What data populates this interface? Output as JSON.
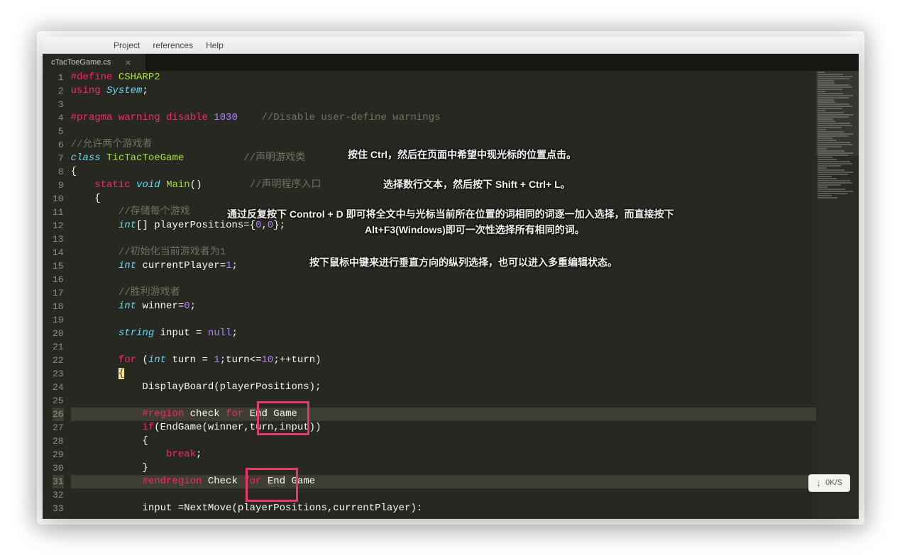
{
  "menubar": {
    "items": [
      "Project",
      "references",
      "Help"
    ]
  },
  "tab": {
    "name": "cTacToeGame.cs",
    "close": "×"
  },
  "gutter": {
    "start": 1,
    "end": 33
  },
  "code_lines": [
    [
      {
        "c": "kw-red",
        "t": "#define"
      },
      {
        "c": "white",
        "t": " "
      },
      {
        "c": "name",
        "t": "CSHARP2"
      }
    ],
    [
      {
        "c": "kw-red",
        "t": "using"
      },
      {
        "c": "white",
        "t": " "
      },
      {
        "c": "kw-blue",
        "t": "System"
      },
      {
        "c": "white",
        "t": ";"
      }
    ],
    [],
    [
      {
        "c": "kw-red",
        "t": "#pragma warning disable"
      },
      {
        "c": "white",
        "t": " "
      },
      {
        "c": "num",
        "t": "1030"
      },
      {
        "c": "white",
        "t": "    "
      },
      {
        "c": "cmt",
        "t": "//Disable user-define warnings"
      }
    ],
    [],
    [
      {
        "c": "cmt",
        "t": "//允许两个游戏者"
      }
    ],
    [
      {
        "c": "kw-blue",
        "t": "class"
      },
      {
        "c": "white",
        "t": " "
      },
      {
        "c": "name",
        "t": "TicTacToeGame"
      },
      {
        "c": "white",
        "t": "          "
      },
      {
        "c": "cmt",
        "t": "//声明游戏类"
      }
    ],
    [
      {
        "c": "white",
        "t": "{"
      }
    ],
    [
      {
        "c": "white",
        "t": "    "
      },
      {
        "c": "kw-red",
        "t": "static"
      },
      {
        "c": "white",
        "t": " "
      },
      {
        "c": "kw-blue",
        "t": "void"
      },
      {
        "c": "white",
        "t": " "
      },
      {
        "c": "fn",
        "t": "Main"
      },
      {
        "c": "white",
        "t": "()        "
      },
      {
        "c": "cmt",
        "t": "//声明程序入口"
      }
    ],
    [
      {
        "c": "white",
        "t": "    {"
      }
    ],
    [
      {
        "c": "white",
        "t": "        "
      },
      {
        "c": "cmt",
        "t": "//存储每个游戏"
      }
    ],
    [
      {
        "c": "white",
        "t": "        "
      },
      {
        "c": "kw-blue",
        "t": "int"
      },
      {
        "c": "white",
        "t": "[] playerPositions={"
      },
      {
        "c": "num",
        "t": "0"
      },
      {
        "c": "white",
        "t": ","
      },
      {
        "c": "num",
        "t": "0"
      },
      {
        "c": "white",
        "t": "};"
      }
    ],
    [],
    [
      {
        "c": "white",
        "t": "        "
      },
      {
        "c": "cmt",
        "t": "//初始化当前游戏者为1"
      }
    ],
    [
      {
        "c": "white",
        "t": "        "
      },
      {
        "c": "kw-blue",
        "t": "int"
      },
      {
        "c": "white",
        "t": " currentPlayer="
      },
      {
        "c": "num",
        "t": "1"
      },
      {
        "c": "white",
        "t": ";"
      }
    ],
    [],
    [
      {
        "c": "white",
        "t": "        "
      },
      {
        "c": "cmt",
        "t": "//胜利游戏者"
      }
    ],
    [
      {
        "c": "white",
        "t": "        "
      },
      {
        "c": "kw-blue",
        "t": "int"
      },
      {
        "c": "white",
        "t": " winner="
      },
      {
        "c": "num",
        "t": "0"
      },
      {
        "c": "white",
        "t": ";"
      }
    ],
    [],
    [
      {
        "c": "white",
        "t": "        "
      },
      {
        "c": "kw-blue",
        "t": "string"
      },
      {
        "c": "white",
        "t": " input = "
      },
      {
        "c": "num",
        "t": "null"
      },
      {
        "c": "white",
        "t": ";"
      }
    ],
    [],
    [
      {
        "c": "white",
        "t": "        "
      },
      {
        "c": "kw-red",
        "t": "for"
      },
      {
        "c": "white",
        "t": " ("
      },
      {
        "c": "kw-blue",
        "t": "int"
      },
      {
        "c": "white",
        "t": " turn = "
      },
      {
        "c": "num",
        "t": "1"
      },
      {
        "c": "white",
        "t": ";turn<="
      },
      {
        "c": "num",
        "t": "10"
      },
      {
        "c": "white",
        "t": ";++turn)"
      }
    ],
    [
      {
        "c": "white",
        "t": "        "
      },
      {
        "c": "bracket-hl",
        "t": "{"
      }
    ],
    [
      {
        "c": "white",
        "t": "            DisplayBoard(playerPositions);"
      }
    ],
    [],
    [
      {
        "c": "white",
        "t": "            "
      },
      {
        "c": "kw-red",
        "t": "#region"
      },
      {
        "c": "white",
        "t": " check "
      },
      {
        "c": "kw-red",
        "t": "for"
      },
      {
        "c": "white",
        "t": " "
      },
      {
        "c": "sel",
        "t": "End"
      },
      {
        "c": "white",
        "t": " Game"
      }
    ],
    [
      {
        "c": "white",
        "t": "            "
      },
      {
        "c": "kw-red",
        "t": "if"
      },
      {
        "c": "white",
        "t": "(EndGame(winner,turn,input))"
      }
    ],
    [
      {
        "c": "white",
        "t": "            {"
      }
    ],
    [
      {
        "c": "white",
        "t": "                "
      },
      {
        "c": "kw-red",
        "t": "break"
      },
      {
        "c": "white",
        "t": ";"
      }
    ],
    [
      {
        "c": "white",
        "t": "            }"
      }
    ],
    [
      {
        "c": "white",
        "t": "            "
      },
      {
        "c": "kw-red",
        "t": "#endregion"
      },
      {
        "c": "white",
        "t": " Check "
      },
      {
        "c": "kw-red",
        "t": "for"
      },
      {
        "c": "white",
        "t": " "
      },
      {
        "c": "sel",
        "t": "End"
      },
      {
        "c": "white",
        "t": " Game"
      }
    ],
    [],
    [
      {
        "c": "white",
        "t": "            input =NextMove(playerPositions,currentPlayer):"
      }
    ]
  ],
  "highlighted_lines": [
    26,
    31
  ],
  "tips": {
    "t1": "按住 Ctrl，然后在页面中希望中现光标的位置点击。",
    "t2": "选择数行文本，然后按下 Shift + Ctrl+ L。",
    "t3a": "通过反复按下 Control + D 即可将全文中与光标当前所在位置的词相同的词逐一加入选择，而直接按下",
    "t3b": "Alt+F3(Windows)即可一次性选择所有相同的词。",
    "t4": "按下鼠标中键来进行垂直方向的纵列选择，也可以进入多重编辑状态。"
  },
  "badge": {
    "arrow": "↓",
    "text": "0K/S"
  }
}
